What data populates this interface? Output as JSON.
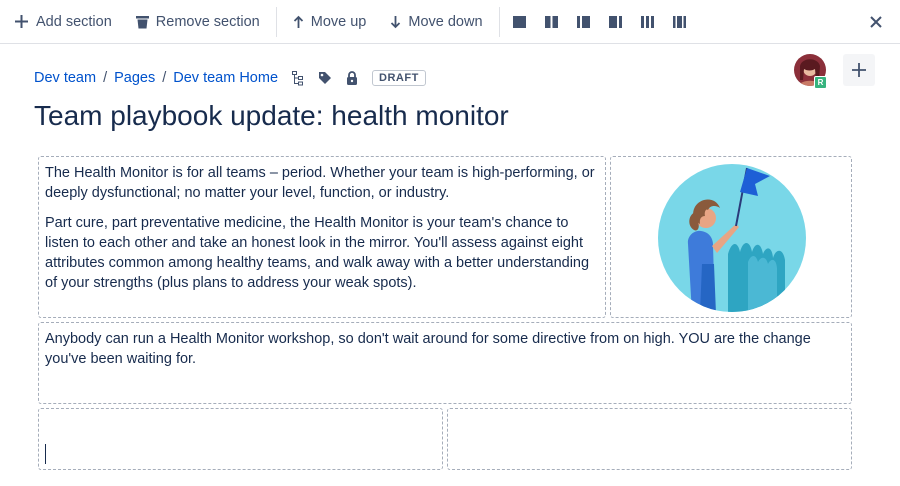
{
  "toolbar": {
    "add_section": "Add section",
    "remove_section": "Remove section",
    "move_up": "Move up",
    "move_down": "Move down",
    "layouts": [
      "single-column",
      "two-columns",
      "sidebar-left",
      "sidebar-right",
      "three-columns",
      "three-columns-sidebars"
    ]
  },
  "breadcrumb": {
    "items": [
      "Dev team",
      "Pages",
      "Dev team Home"
    ],
    "separator": "/",
    "icons": [
      "page-tree-icon",
      "tag-icon",
      "lock-icon"
    ],
    "status": "DRAFT"
  },
  "user": {
    "avatar_badge": "R"
  },
  "page": {
    "title": "Team playbook update: health monitor"
  },
  "content": {
    "section1_p1": "The Health Monitor is for all teams – period. Whether your team is high-performing, or deeply dysfunctional; no matter your level, function, or industry.",
    "section1_p2": "Part cure, part preventative medicine, the Health Monitor is your team's chance to listen to each other and take an honest look in the mirror. You'll assess against eight attributes common among healthy teams, and walk away with a better understanding of your strengths (plus plans to address your weak spots).",
    "section2_p1": "Anybody can run a Health Monitor workshop, so don't wait around for some directive from on high. YOU are the change you've been waiting for."
  },
  "colors": {
    "link": "#0052CC",
    "text": "#172B4D",
    "icon": "#42526E",
    "avatar_badge": "#36B37E"
  }
}
